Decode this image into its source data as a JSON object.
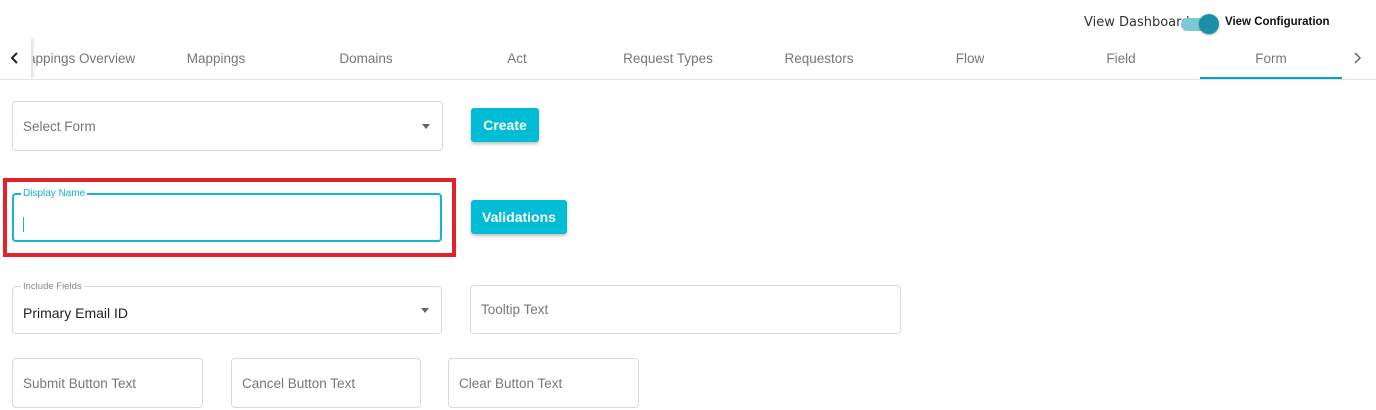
{
  "header": {
    "view_dashboard_label": "View Dashboard",
    "view_configuration_label": "View Configuration",
    "toggle_on": true
  },
  "tabs": {
    "items": [
      {
        "label": "Mappings Overview"
      },
      {
        "label": "Mappings"
      },
      {
        "label": "Domains"
      },
      {
        "label": "Act"
      },
      {
        "label": "Request Types"
      },
      {
        "label": "Requestors"
      },
      {
        "label": "Flow"
      },
      {
        "label": "Field"
      },
      {
        "label": "Form"
      }
    ],
    "active": "Form",
    "prev_icon": "chevron-left-icon",
    "next_icon": "chevron-right-icon"
  },
  "form": {
    "select_form_placeholder": "Select Form",
    "create_button": "Create",
    "display_name_label": "Display Name",
    "display_name_value": "",
    "validations_button": "Validations",
    "include_fields_label": "Include Fields",
    "include_fields_value": "Primary Email ID",
    "tooltip_placeholder": "Tooltip Text",
    "submit_button_placeholder": "Submit Button Text",
    "cancel_button_placeholder": "Cancel Button Text",
    "clear_button_placeholder": "Clear Button Text"
  },
  "colors": {
    "accent": "#00bcd4",
    "highlight": "#e3222b"
  }
}
